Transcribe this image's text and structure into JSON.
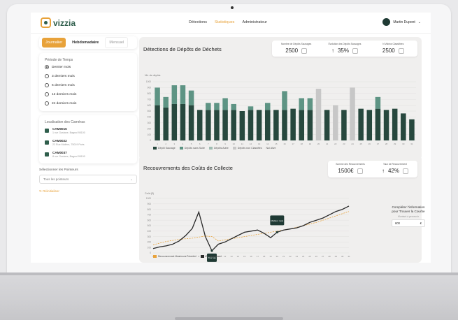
{
  "app": {
    "logo_text": "vizzia",
    "nav": [
      "Détections",
      "Statistiques",
      "Administrateur"
    ],
    "active_nav_index": 1,
    "user_name": "Martin Dupont"
  },
  "sidebar": {
    "period_tabs": [
      "Journalier",
      "Hebdomadaire",
      "Mensuel"
    ],
    "timeframe_title": "Période de Temps",
    "timeframe_options": [
      "Dernier mois",
      "3 derniers mois",
      "6 derniers mois",
      "12 derniers mois",
      "24 derniers mois"
    ],
    "timeframe_selected": 0,
    "cameras_title": "Localisation des Caméras",
    "cameras": [
      {
        "name": "CAM0015",
        "sub": "1 rue Gustave, Bagnol 95100"
      },
      {
        "name": "CAM0022",
        "sub": "22 Rue Molière, 75019 Paris"
      },
      {
        "name": "CAM0037",
        "sub": "8 rue Gustave, Bagnol 95100"
      }
    ],
    "select_label": "Sélectionner les Pointeurs",
    "select_value": "Tous les pointeurs",
    "reset_label": "Réinitialiser"
  },
  "detections": {
    "title": "Détections de Dépôts de Déchets",
    "kpis": [
      {
        "label": "Nombre de Dépôts Sauvages",
        "value": "2500"
      },
      {
        "label": "Évolution des Dépôts Sauvages",
        "value": "35%"
      },
      {
        "label": "N Vidéos Classifiées",
        "value": "2500"
      }
    ],
    "legend": [
      "Dépôt Sauvage",
      "Dépôts sans Suite",
      "Dépôts Autre",
      "Dépôts non Classifiés",
      "Nul Alive"
    ]
  },
  "costs": {
    "title": "Recouvrements des Coûts de Collecte",
    "kpis": [
      {
        "label": "Somme des Recouvrements",
        "value": "1500€"
      },
      {
        "label": "Taux de Recouvrement",
        "value": "42%"
      }
    ],
    "legend": [
      "Recouvrement Maximum Potentiel",
      "Recouvrement"
    ],
    "widget_title": "Compléter l'information pour Trouver la Courbe",
    "widget_sub": "Montant à percevoir",
    "widget_value": "600",
    "widget_unit": "€"
  },
  "chart_data": [
    {
      "type": "bar",
      "title": "Détections de Dépôts de Déchets",
      "ylabel": "Nb. de dépôts",
      "ylim": [
        0,
        1000
      ],
      "categories": [
        "1",
        "2",
        "3",
        "4",
        "5",
        "6",
        "7",
        "8",
        "9",
        "10",
        "11",
        "12",
        "13",
        "14",
        "15",
        "16",
        "17",
        "18",
        "19",
        "20",
        "21",
        "22",
        "23",
        "24",
        "25",
        "26",
        "27",
        "28",
        "29",
        "30",
        "31"
      ],
      "series": [
        {
          "name": "Dépôt Sauvage",
          "color": "#27483e",
          "values": [
            600,
            560,
            620,
            620,
            600,
            520,
            520,
            520,
            520,
            520,
            500,
            520,
            520,
            520,
            520,
            520,
            540,
            520,
            520,
            0,
            520,
            0,
            520,
            0,
            540,
            520,
            540,
            520,
            540,
            460,
            360
          ]
        },
        {
          "name": "Dépôts sans Suite",
          "color": "#5e9484",
          "values": [
            300,
            180,
            320,
            320,
            250,
            0,
            120,
            120,
            200,
            100,
            0,
            60,
            0,
            120,
            0,
            320,
            0,
            200,
            200,
            0,
            0,
            0,
            0,
            0,
            0,
            0,
            200,
            0,
            0,
            0,
            0
          ]
        },
        {
          "name": "Dépôts non Classifiés",
          "color": "#c7c7c7",
          "values": [
            0,
            0,
            0,
            0,
            0,
            0,
            0,
            0,
            0,
            0,
            0,
            0,
            0,
            0,
            0,
            0,
            0,
            0,
            0,
            880,
            0,
            600,
            0,
            900,
            0,
            0,
            0,
            0,
            0,
            0,
            0
          ]
        }
      ]
    },
    {
      "type": "line",
      "title": "Recouvrements des Coûts de Collecte",
      "ylabel": "Coût (€)",
      "ylim": [
        0,
        1000
      ],
      "x": [
        1,
        2,
        3,
        4,
        5,
        6,
        7,
        8,
        9,
        10,
        11,
        12,
        13,
        14,
        15,
        16,
        17,
        18,
        19,
        20,
        21,
        22,
        23,
        24,
        25,
        26,
        27,
        28,
        29,
        30,
        31
      ],
      "series": [
        {
          "name": "Recouvrement Maximum Potentiel",
          "color": "#e8a23a",
          "style": "dashed",
          "values": [
            150,
            180,
            210,
            230,
            250,
            260,
            270,
            290,
            310,
            300,
            220,
            240,
            260,
            280,
            300,
            320,
            340,
            360,
            380,
            400,
            420,
            440,
            470,
            500,
            530,
            560,
            600,
            640,
            680,
            720,
            760
          ]
        },
        {
          "name": "Recouvrement",
          "color": "#2a2a2a",
          "values": [
            80,
            110,
            130,
            160,
            220,
            320,
            450,
            750,
            300,
            40,
            160,
            200,
            260,
            320,
            380,
            400,
            420,
            360,
            280,
            380,
            420,
            440,
            460,
            500,
            560,
            600,
            640,
            700,
            760,
            800,
            860
          ]
        }
      ],
      "annotations": [
        "Meilleur mois",
        "Plus bas"
      ]
    }
  ]
}
